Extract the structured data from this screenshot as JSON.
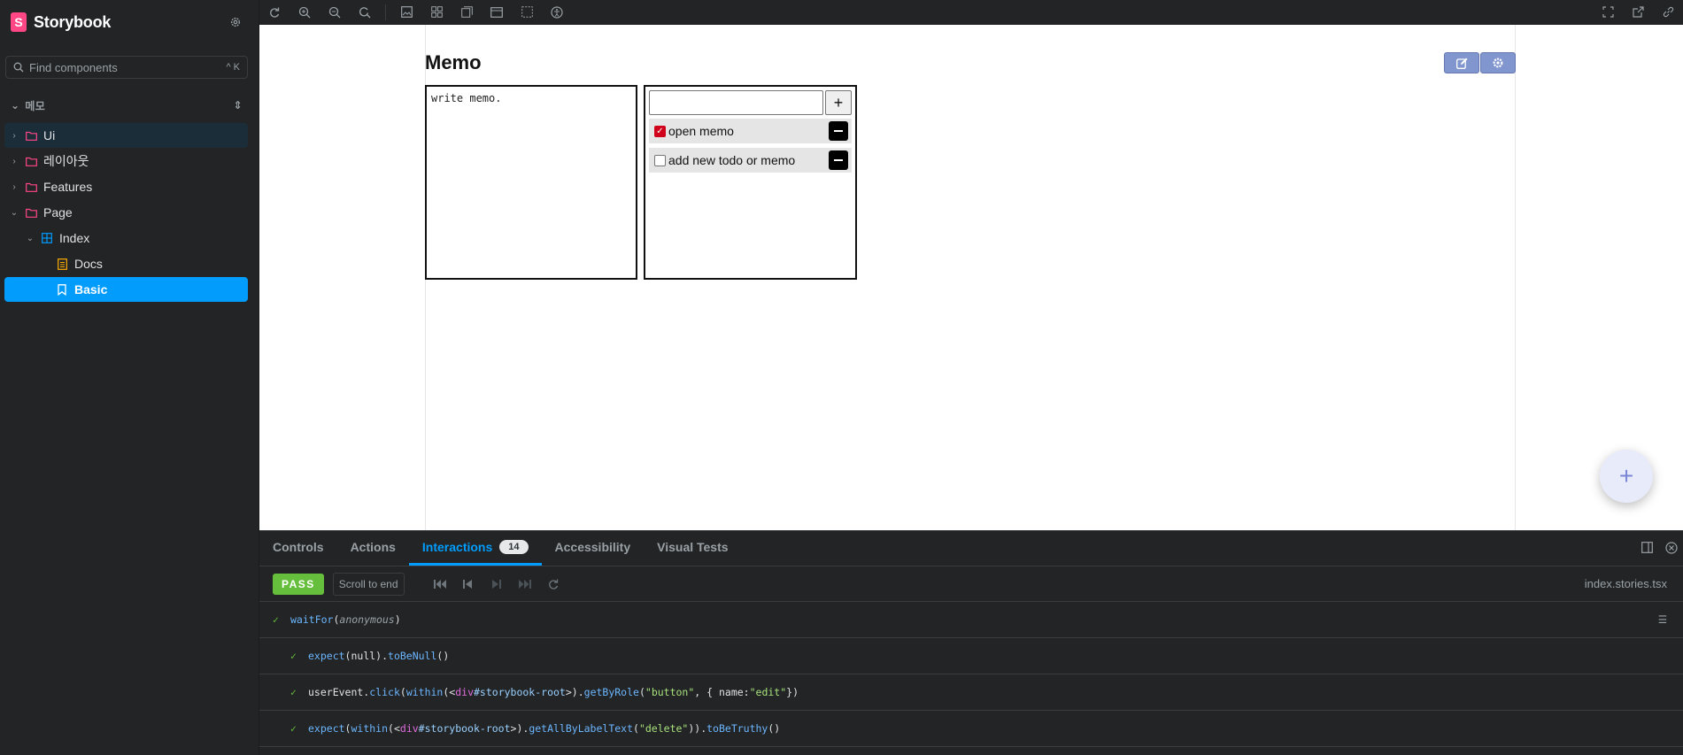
{
  "sidebar": {
    "brand": "Storybook",
    "search_placeholder": "Find components",
    "search_shortcut": "^ K",
    "section_title": "메모",
    "tree": [
      {
        "label": "Ui"
      },
      {
        "label": "레이아웃"
      },
      {
        "label": "Features"
      },
      {
        "label": "Page"
      },
      {
        "label": "Index"
      },
      {
        "label": "Docs"
      },
      {
        "label": "Basic"
      }
    ]
  },
  "toolbar": {
    "left_icons": [
      "remount-icon",
      "zoom-in-icon",
      "zoom-out-icon",
      "zoom-reset-icon",
      "image-icon",
      "grid-icon",
      "background-icon",
      "viewport-icon",
      "outline-icon",
      "accessibility-icon"
    ],
    "right_icons": [
      "fullscreen-icon",
      "open-new-tab-icon",
      "copy-link-icon"
    ]
  },
  "canvas": {
    "title": "Memo",
    "memo_placeholder": "write memo.",
    "todo_input_value": "",
    "add_label": "+",
    "todos": [
      {
        "text": "open memo",
        "checked": true
      },
      {
        "text": "add new todo or memo",
        "checked": false
      }
    ],
    "fab_label": "+"
  },
  "panel": {
    "tabs": [
      {
        "label": "Controls"
      },
      {
        "label": "Actions"
      },
      {
        "label": "Interactions",
        "count": "14"
      },
      {
        "label": "Accessibility"
      },
      {
        "label": "Visual Tests"
      }
    ],
    "status": "PASS",
    "scroll_label": "Scroll to end",
    "file_name": "index.stories.tsx",
    "steps": [
      {
        "fn": "waitFor",
        "p1": "(",
        "arg": "anonymous",
        "p2": ")"
      },
      {
        "a": "expect",
        "b": "(null).",
        "c": "toBeNull",
        "d": "()"
      },
      {
        "a": "userEvent.",
        "b": "click",
        "c": "(",
        "d": "within",
        "e": "(<",
        "f": "div",
        "g": "#storybook-root",
        "h": ">).",
        "i": "getByRole",
        "j": "(",
        "k": "\"button\"",
        "l": ", { name: ",
        "m": "\"edit\"",
        "n": " })"
      },
      {
        "a": "expect",
        "b": "(",
        "c": "within",
        "d": "(<",
        "e": "div",
        "f": "#storybook-root",
        "g": ">).",
        "h": "getAllByLabelText",
        "i": "(",
        "j": "\"delete\"",
        "k": ")).",
        "l": "toBeTruthy",
        "m": "()"
      }
    ]
  },
  "colors": {
    "accent": "#029cfd",
    "brand": "#ff4785",
    "pass": "#66bf3c",
    "checkbox": "#d0021b",
    "edit_buttons": "#8195cf"
  }
}
